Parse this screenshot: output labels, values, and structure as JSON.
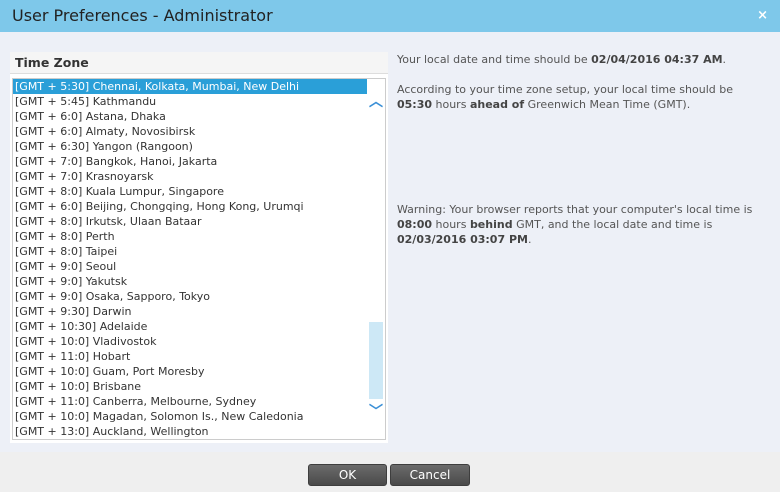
{
  "window": {
    "title": "User Preferences - Administrator",
    "close_icon": "×"
  },
  "timezone": {
    "header": "Time Zone",
    "selected": "[GMT + 5:30] Chennai, Kolkata, Mumbai, New Delhi",
    "items": [
      "[GMT + 5:30] Chennai, Kolkata, Mumbai, New Delhi",
      "[GMT + 5:45] Kathmandu",
      "[GMT + 6:0] Astana, Dhaka",
      "[GMT + 6:0] Almaty, Novosibirsk",
      "[GMT + 6:30] Yangon (Rangoon)",
      "[GMT + 7:0] Bangkok, Hanoi, Jakarta",
      "[GMT + 7:0] Krasnoyarsk",
      "[GMT + 8:0] Kuala Lumpur, Singapore",
      "[GMT + 6:0] Beijing, Chongqing, Hong Kong, Urumqi",
      "[GMT + 8:0] Irkutsk, Ulaan Bataar",
      "[GMT + 8:0] Perth",
      "[GMT + 8:0] Taipei",
      "[GMT + 9:0] Seoul",
      "[GMT + 9:0] Yakutsk",
      "[GMT + 9:0] Osaka, Sapporo, Tokyo",
      "[GMT + 9:30] Darwin",
      "[GMT + 10:30] Adelaide",
      "[GMT + 10:0] Vladivostok",
      "[GMT + 11:0] Hobart",
      "[GMT + 10:0] Guam, Port Moresby",
      "[GMT + 10:0] Brisbane",
      "[GMT + 11:0] Canberra, Melbourne, Sydney",
      "[GMT + 10:0] Magadan, Solomon Is., New Caledonia",
      "[GMT + 13:0] Auckland, Wellington"
    ],
    "scroll_position_percent": 85
  },
  "info": {
    "p1": {
      "a": "Your local date and time should be ",
      "b": "02/04/2016 04:37 AM",
      "c": "."
    },
    "p2": {
      "a": "According to your time zone setup, your local time should be ",
      "b": "05:30",
      "c": " hours ",
      "d": "ahead of",
      "e": " Greenwich Mean Time (GMT)."
    },
    "p3": {
      "a": "Warning: Your browser reports that your computer's local time is ",
      "b": "08:00",
      "c": " hours ",
      "d": "behind",
      "e": " GMT, and the local date and time is ",
      "f": "02/03/2016 03:07 PM",
      "g": "."
    }
  },
  "buttons": {
    "ok": "OK",
    "cancel": "Cancel"
  },
  "colors": {
    "titlebar": "#7ec8ea",
    "selection": "#2a9fd8",
    "accent": "#3a8fd6"
  }
}
